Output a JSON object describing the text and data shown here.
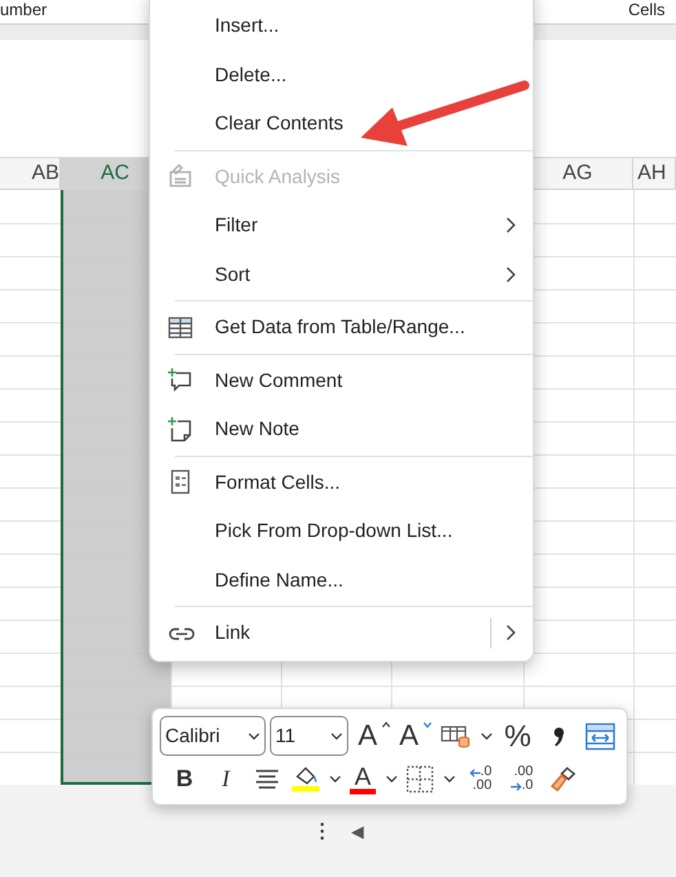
{
  "ribbon": {
    "left_label": "umber",
    "right_label": "Cells"
  },
  "sheet": {
    "columns": [
      {
        "label": "AB",
        "selected": false
      },
      {
        "label": "AC",
        "selected": true
      },
      {
        "label": "AG",
        "selected": false
      },
      {
        "label": "AH",
        "selected": false
      }
    ]
  },
  "context_menu": {
    "items": [
      {
        "kind": "command",
        "label": "Insert...",
        "disabled": false
      },
      {
        "kind": "command",
        "label": "Delete...",
        "disabled": false
      },
      {
        "kind": "command",
        "label": "Clear Contents",
        "disabled": false
      },
      {
        "kind": "separator"
      },
      {
        "kind": "command",
        "label": "Quick Analysis",
        "disabled": true
      },
      {
        "kind": "submenu",
        "label": "Filter",
        "disabled": false
      },
      {
        "kind": "submenu",
        "label": "Sort",
        "disabled": false
      },
      {
        "kind": "separator"
      },
      {
        "kind": "command",
        "label": "Get Data from Table/Range...",
        "disabled": false
      },
      {
        "kind": "separator"
      },
      {
        "kind": "command",
        "label": "New Comment",
        "disabled": false
      },
      {
        "kind": "command",
        "label": "New Note",
        "disabled": false
      },
      {
        "kind": "separator"
      },
      {
        "kind": "command",
        "label": "Format Cells...",
        "disabled": false
      },
      {
        "kind": "command",
        "label": "Pick From Drop-down List...",
        "disabled": false
      },
      {
        "kind": "command",
        "label": "Define Name...",
        "disabled": false
      },
      {
        "kind": "separator"
      },
      {
        "kind": "split_submenu",
        "label": "Link",
        "disabled": false
      }
    ]
  },
  "mini_toolbar": {
    "font": "Calibri",
    "size": "11",
    "row_1": [
      {
        "kind": "grow_font",
        "glyph": "A",
        "dropdown": false
      },
      {
        "kind": "shrink_font",
        "glyph": "A",
        "dropdown": false
      },
      {
        "kind": "table_style",
        "dropdown": true
      },
      {
        "kind": "percent",
        "glyph": "%",
        "dropdown": false
      },
      {
        "kind": "comma",
        "dropdown": false
      },
      {
        "kind": "wrap",
        "dropdown": false
      }
    ],
    "row_2": [
      {
        "kind": "bold",
        "glyph": "B",
        "dropdown": false
      },
      {
        "kind": "italic",
        "glyph": "I",
        "dropdown": false
      },
      {
        "kind": "align",
        "dropdown": false
      },
      {
        "kind": "fill_color",
        "color": "#ffff00",
        "dropdown": true
      },
      {
        "kind": "font_color",
        "glyph": "A",
        "color": "#ff0000",
        "dropdown": true
      },
      {
        "kind": "borders",
        "dropdown": true
      },
      {
        "kind": "increase_decimal",
        "top": ".0",
        "bottom": ".00",
        "dropdown": false
      },
      {
        "kind": "decrease_decimal",
        "top": ".00",
        "bottom": ".0",
        "dropdown": false
      },
      {
        "kind": "format_painter",
        "dropdown": false
      }
    ]
  },
  "status_bar": {
    "more": "⋮",
    "scroll_left": "◀"
  }
}
